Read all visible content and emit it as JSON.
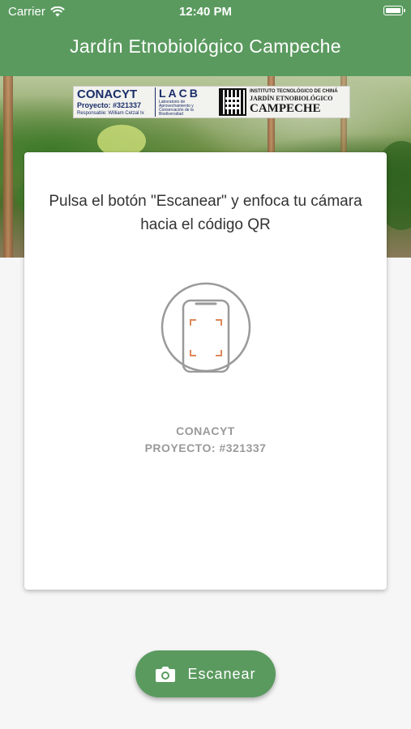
{
  "status_bar": {
    "carrier": "Carrier",
    "time": "12:40 PM"
  },
  "nav": {
    "title": "Jardín Etnobiológico Campeche"
  },
  "banner": {
    "conacyt": "CONACYT",
    "proyecto": "Proyecto: #321337",
    "responsable": "Responsable: William Cetzal Ix",
    "lacb": "LACB",
    "lacb_sub": "Laboratorio de Aprovechamiento y Conservación de la Biodiversidad",
    "instituto": "INSTITUTO TECNOLÓGICO DE CHINÁ",
    "jardin": "JARDÍN ETNOBIOLÓGICO",
    "campeche": "CAMPECHE"
  },
  "card": {
    "instruction": "Pulsa el botón \"Escanear\" y enfoca tu cámara hacia el código QR",
    "sponsor_line1": "CONACYT",
    "sponsor_line2": "PROYECTO: #321337"
  },
  "scan_button": {
    "label": "Escanear",
    "icon": "camera-icon"
  },
  "colors": {
    "primary": "#5a9a5f",
    "frame_corners": "#e0875a",
    "illustration_gray": "#9a9a9a"
  }
}
